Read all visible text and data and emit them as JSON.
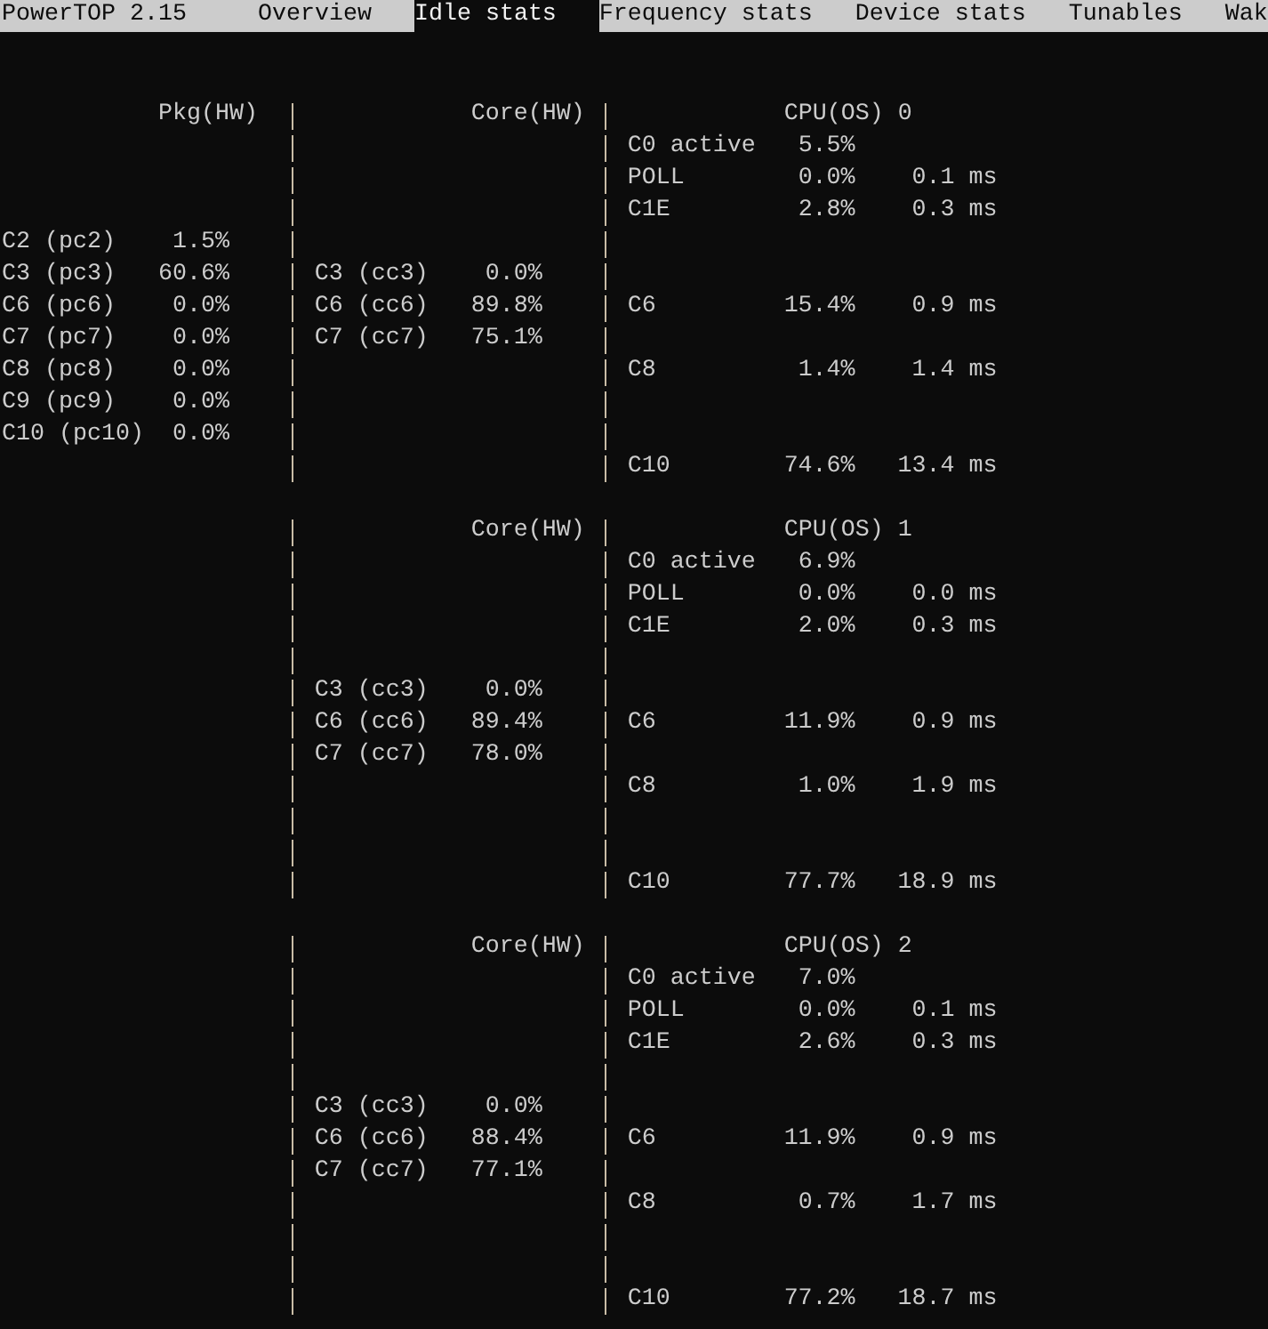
{
  "title": "PowerTOP 2.15",
  "tabs": [
    {
      "label": "Overview",
      "selected": false
    },
    {
      "label": "Idle stats",
      "selected": true
    },
    {
      "label": "Frequency stats",
      "selected": false
    },
    {
      "label": "Device stats",
      "selected": false
    },
    {
      "label": "Tunables",
      "selected": false
    },
    {
      "label": "Wak",
      "selected": false
    }
  ],
  "blocks": [
    {
      "pkg_header": "Pkg(HW)",
      "core_header": "Core(HW)",
      "cpu_header": "CPU(OS) 0",
      "rows": [
        {
          "cpu": {
            "state": "C0 active",
            "percent": "5.5%"
          }
        },
        {
          "cpu": {
            "state": "POLL",
            "percent": "0.0%",
            "time": "0.1 ms"
          }
        },
        {
          "cpu": {
            "state": "C1E",
            "percent": "2.8%",
            "time": "0.3 ms"
          }
        },
        {
          "pkg": {
            "state": "C2 (pc2)",
            "percent": "1.5%"
          }
        },
        {
          "pkg": {
            "state": "C3 (pc3)",
            "percent": "60.6%"
          },
          "core": {
            "state": "C3 (cc3)",
            "percent": "0.0%"
          }
        },
        {
          "pkg": {
            "state": "C6 (pc6)",
            "percent": "0.0%"
          },
          "core": {
            "state": "C6 (cc6)",
            "percent": "89.8%"
          },
          "cpu": {
            "state": "C6",
            "percent": "15.4%",
            "time": "0.9 ms"
          }
        },
        {
          "pkg": {
            "state": "C7 (pc7)",
            "percent": "0.0%"
          },
          "core": {
            "state": "C7 (cc7)",
            "percent": "75.1%"
          }
        },
        {
          "pkg": {
            "state": "C8 (pc8)",
            "percent": "0.0%"
          },
          "cpu": {
            "state": "C8",
            "percent": "1.4%",
            "time": "1.4 ms"
          }
        },
        {
          "pkg": {
            "state": "C9 (pc9)",
            "percent": "0.0%"
          }
        },
        {
          "pkg": {
            "state": "C10 (pc10)",
            "percent": "0.0%"
          }
        },
        {
          "cpu": {
            "state": "C10",
            "percent": "74.6%",
            "time": "13.4 ms"
          }
        }
      ]
    },
    {
      "core_header": "Core(HW)",
      "cpu_header": "CPU(OS) 1",
      "rows": [
        {
          "cpu": {
            "state": "C0 active",
            "percent": "6.9%"
          }
        },
        {
          "cpu": {
            "state": "POLL",
            "percent": "0.0%",
            "time": "0.0 ms"
          }
        },
        {
          "cpu": {
            "state": "C1E",
            "percent": "2.0%",
            "time": "0.3 ms"
          }
        },
        {},
        {
          "core": {
            "state": "C3 (cc3)",
            "percent": "0.0%"
          }
        },
        {
          "core": {
            "state": "C6 (cc6)",
            "percent": "89.4%"
          },
          "cpu": {
            "state": "C6",
            "percent": "11.9%",
            "time": "0.9 ms"
          }
        },
        {
          "core": {
            "state": "C7 (cc7)",
            "percent": "78.0%"
          }
        },
        {
          "cpu": {
            "state": "C8",
            "percent": "1.0%",
            "time": "1.9 ms"
          }
        },
        {},
        {},
        {
          "cpu": {
            "state": "C10",
            "percent": "77.7%",
            "time": "18.9 ms"
          }
        }
      ]
    },
    {
      "core_header": "Core(HW)",
      "cpu_header": "CPU(OS) 2",
      "rows": [
        {
          "cpu": {
            "state": "C0 active",
            "percent": "7.0%"
          }
        },
        {
          "cpu": {
            "state": "POLL",
            "percent": "0.0%",
            "time": "0.1 ms"
          }
        },
        {
          "cpu": {
            "state": "C1E",
            "percent": "2.6%",
            "time": "0.3 ms"
          }
        },
        {},
        {
          "core": {
            "state": "C3 (cc3)",
            "percent": "0.0%"
          }
        },
        {
          "core": {
            "state": "C6 (cc6)",
            "percent": "88.4%"
          },
          "cpu": {
            "state": "C6",
            "percent": "11.9%",
            "time": "0.9 ms"
          }
        },
        {
          "core": {
            "state": "C7 (cc7)",
            "percent": "77.1%"
          }
        },
        {
          "cpu": {
            "state": "C8",
            "percent": "0.7%",
            "time": "1.7 ms"
          }
        },
        {},
        {},
        {
          "cpu": {
            "state": "C10",
            "percent": "77.2%",
            "time": "18.7 ms"
          }
        }
      ]
    }
  ]
}
